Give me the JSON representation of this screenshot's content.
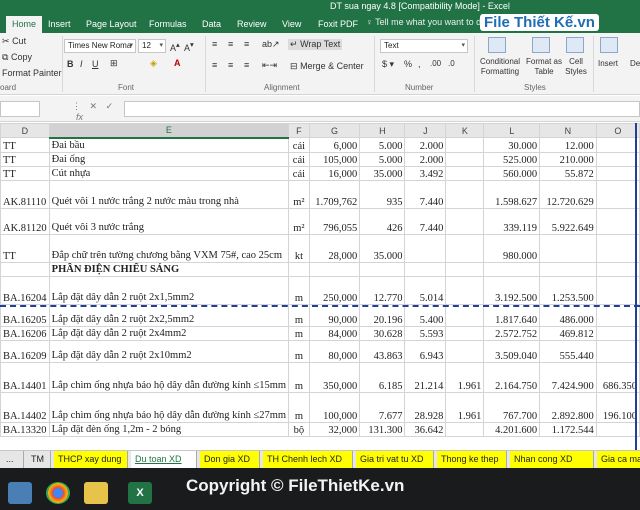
{
  "window": {
    "title": "DT sua ngay 4.8  [Compatibility Mode] - Excel"
  },
  "ribbon_tabs": [
    "Home",
    "Insert",
    "Page Layout",
    "Formulas",
    "Data",
    "Review",
    "View",
    "Foxit PDF"
  ],
  "tell_me": "Tell me what you want to do...",
  "logo": "File Thiết Kế.vn",
  "clipboard": {
    "cut": "Cut",
    "copy": "Copy",
    "format_painter": "Format Painter",
    "label": "oard"
  },
  "font": {
    "name": "Times New Roma",
    "size": "12",
    "label": "Font"
  },
  "alignment": {
    "wrap_text": "Wrap Text",
    "merge_center": "Merge & Center",
    "label": "Alignment"
  },
  "number": {
    "format": "Text",
    "label": "Number"
  },
  "styles": {
    "conditional": "Conditional Formatting",
    "format_table": "Format as Table",
    "cell_styles": "Cell Styles",
    "label": "Styles"
  },
  "cells": {
    "insert": "Insert",
    "delete": "De"
  },
  "formula_bar": {
    "fx": "fx"
  },
  "columns": [
    "D",
    "E",
    "F",
    "G",
    "H",
    "J",
    "K",
    "L",
    "N",
    "O"
  ],
  "rows": [
    {
      "d": "TT",
      "e": "Đai bầu",
      "f": "cái",
      "g": "6,000",
      "h": "5.000",
      "j": "2.000",
      "k": "",
      "l": "30.000",
      "n": "12.000",
      "o": ""
    },
    {
      "d": "TT",
      "e": "Đai ống",
      "f": "cái",
      "g": "105,000",
      "h": "5.000",
      "j": "2.000",
      "k": "",
      "l": "525.000",
      "n": "210.000",
      "o": ""
    },
    {
      "d": "TT",
      "e": "Cút nhựa",
      "f": "cái",
      "g": "16,000",
      "h": "35.000",
      "j": "3.492",
      "k": "",
      "l": "560.000",
      "n": "55.872",
      "o": ""
    },
    {
      "d": "AK.81110",
      "e": "Quét vôi 1 nước trắng 2 nước màu trong nhà",
      "f": "m²",
      "g": "1.709,762",
      "h": "935",
      "j": "7.440",
      "k": "",
      "l": "1.598.627",
      "n": "12.720.629",
      "o": ""
    },
    {
      "d": "AK.81120",
      "e": "Quét vôi 3 nước trắng",
      "f": "m²",
      "g": "796,055",
      "h": "426",
      "j": "7.440",
      "k": "",
      "l": "339.119",
      "n": "5.922.649",
      "o": ""
    },
    {
      "d": "TT",
      "e": "Đắp chữ trên tường chương bằng VXM 75#, cao 25cm",
      "f": "kt",
      "g": "28,000",
      "h": "35.000",
      "j": "",
      "k": "",
      "l": "980.000",
      "n": "",
      "o": ""
    },
    {
      "d": "",
      "e": "PHẦN ĐIỆN CHIẾU SÁNG",
      "f": "",
      "g": "",
      "h": "",
      "j": "",
      "k": "",
      "l": "",
      "n": "",
      "o": "",
      "bold": true
    },
    {
      "d": "BA.16204",
      "e": "Lắp đặt dây dẫn 2 ruột 2x1,5mm2",
      "f": "m",
      "g": "250,000",
      "h": "12.770",
      "j": "5.014",
      "k": "",
      "l": "3.192.500",
      "n": "1.253.500",
      "o": ""
    },
    {
      "d": "BA.16205",
      "e": "Lắp đặt dây dẫn 2 ruột 2x2,5mm2",
      "f": "m",
      "g": "90,000",
      "h": "20.196",
      "j": "5.400",
      "k": "",
      "l": "1.817.640",
      "n": "486.000",
      "o": ""
    },
    {
      "d": "BA.16206",
      "e": "Lắp đặt dây dẫn 2 ruột 2x4mm2",
      "f": "m",
      "g": "84,000",
      "h": "30.628",
      "j": "5.593",
      "k": "",
      "l": "2.572.752",
      "n": "469.812",
      "o": ""
    },
    {
      "d": "BA.16209",
      "e": "Lắp đặt dây dẫn 2 ruột 2x10mm2",
      "f": "m",
      "g": "80,000",
      "h": "43.863",
      "j": "6.943",
      "k": "",
      "l": "3.509.040",
      "n": "555.440",
      "o": ""
    },
    {
      "d": "BA.14401",
      "e": "Lắp chìm ống nhựa bảo hộ dây dẫn đường kính ≤15mm",
      "f": "m",
      "g": "350,000",
      "h": "6.185",
      "j": "21.214",
      "k": "1.961",
      "l": "2.164.750",
      "n": "7.424.900",
      "o": "686.350"
    },
    {
      "d": "BA.14402",
      "e": "Lắp chìm ống nhựa bảo hộ dây dẫn đường kính ≤27mm",
      "f": "m",
      "g": "100,000",
      "h": "7.677",
      "j": "28.928",
      "k": "1.961",
      "l": "767.700",
      "n": "2.892.800",
      "o": "196.100"
    },
    {
      "d": "BA.13320",
      "e": "Lắp đặt đèn ống 1,2m - 2 bóng",
      "f": "bộ",
      "g": "32,000",
      "h": "131.300",
      "j": "36.642",
      "k": "",
      "l": "4.201.600",
      "n": "1.172.544",
      "o": ""
    }
  ],
  "sheet_tabs": [
    {
      "label": "...",
      "style": "plain"
    },
    {
      "label": "TM",
      "style": "plain"
    },
    {
      "label": "THCP xay dung",
      "style": "yellow"
    },
    {
      "label": "Du toan XD",
      "style": "active"
    },
    {
      "label": "Don gia XD",
      "style": "yellow"
    },
    {
      "label": "TH Chenh lech XD",
      "style": "yellow"
    },
    {
      "label": "Gia tri vat tu XD",
      "style": "yellow"
    },
    {
      "label": "Thong ke thep",
      "style": "yellow"
    },
    {
      "label": "Nhan cong XD",
      "style": "yellow"
    },
    {
      "label": "Gia ca may",
      "style": "yellow"
    }
  ],
  "watermark": "Copyright © FileThietKe.vn",
  "colors": {
    "excel_green": "#217346",
    "tab_yellow": "#ffff00",
    "page_break": "#1f3f99"
  }
}
